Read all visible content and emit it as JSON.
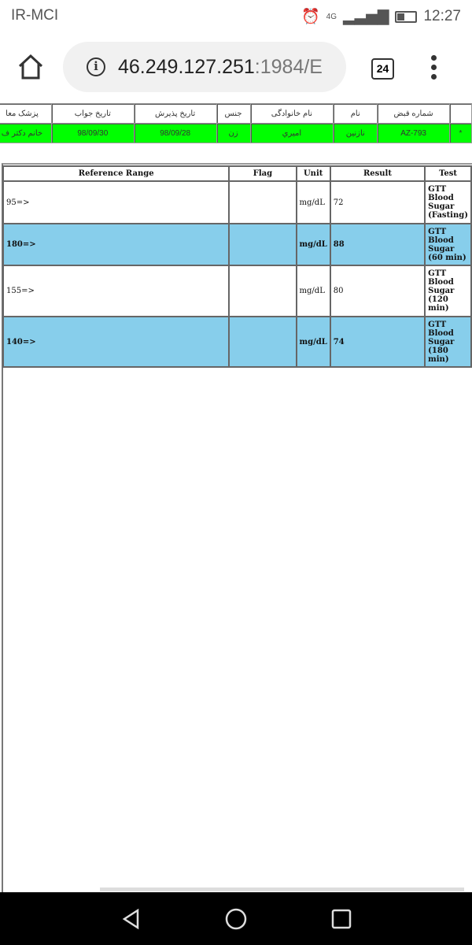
{
  "status_bar": {
    "carrier": "IR-MCI",
    "network": "4G",
    "time": "12:27"
  },
  "browser": {
    "url_host": "46.249.127.251",
    "url_rest": ":1984/E",
    "tab_count": "24"
  },
  "patient_table": {
    "headers": [
      "شماره قبض",
      "نام",
      "نام خانوادگی",
      "جنس",
      "تاریخ پذیرش",
      "تاریخ جواب",
      "پزشک معا"
    ],
    "row": {
      "marker": "*",
      "receipt": "AZ-793",
      "first_name": "نازنین",
      "last_name": "امیري",
      "gender": "زن",
      "admission_date": "98/09/28",
      "answer_date": "98/09/30",
      "doctor": "خانم دکتر ف"
    },
    "row_color": "#00ff00"
  },
  "results_table": {
    "headers": {
      "reference_range": "Reference Range",
      "flag": "Flag",
      "unit": "Unit",
      "result": "Result",
      "test": "Test"
    },
    "rows": [
      {
        "reference_range": "95=>",
        "flag": "",
        "unit": "mg/dL",
        "result": "72",
        "test": "GTT Blood Sugar (Fasting)"
      },
      {
        "reference_range": "180=>",
        "flag": "",
        "unit": "mg/dL",
        "result": "88",
        "test": "GTT Blood Sugar (60 min)"
      },
      {
        "reference_range": "155=>",
        "flag": "",
        "unit": "mg/dL",
        "result": "80",
        "test": "GTT Blood Sugar (120 min)"
      },
      {
        "reference_range": "140=>",
        "flag": "",
        "unit": "mg/dL",
        "result": "74",
        "test": "GTT Blood Sugar (180 min)"
      }
    ],
    "alt_row_color": "#87ceeb"
  }
}
